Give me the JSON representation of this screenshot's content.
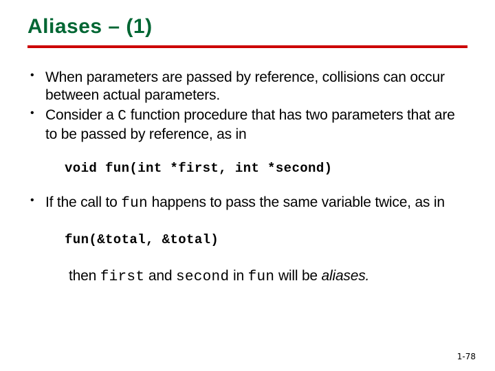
{
  "title": "Aliases – (1)",
  "bullets": {
    "b1a": "When parameters are passed by reference, collisions can occur between actual parameters.",
    "b2a": "Consider a ",
    "b2b": "C",
    "b2c": " function procedure that has two parameters that are to be passed by reference, as in",
    "b3a": "If the call to ",
    "b3b": "fun",
    "b3c": " happens to pass the same variable twice, as in"
  },
  "code": {
    "sig": "void fun(int *first, int *second)",
    "call": "fun(&total, &total)"
  },
  "conclusion": {
    "c1": "then ",
    "c2": "first",
    "c3": " and ",
    "c4": "second",
    "c5": " in ",
    "c6": "fun",
    "c7": " will be ",
    "c8": "aliases."
  },
  "footer": "1-78"
}
